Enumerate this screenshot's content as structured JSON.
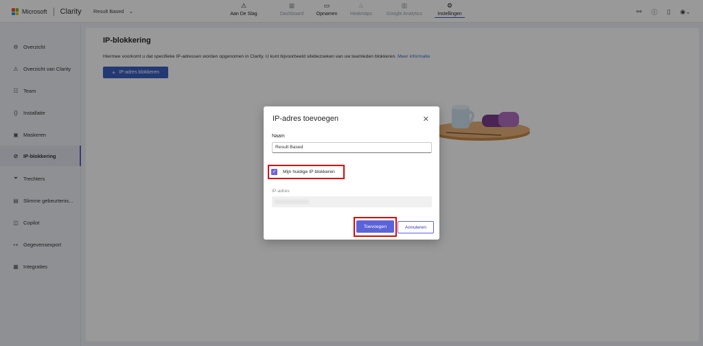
{
  "topbar": {
    "brand": "Microsoft",
    "product": "Clarity",
    "project": "Result Based",
    "nav": [
      {
        "label": "Aan De Slag",
        "icon": "warning-triangle-icon"
      },
      {
        "label": "Dashboard",
        "icon": "dashboard-icon"
      },
      {
        "label": "Opnamen",
        "icon": "video-camera-icon"
      },
      {
        "label": "Heatmaps",
        "icon": "flame-icon"
      },
      {
        "label": "Google Analytics",
        "icon": "bar-chart-icon"
      },
      {
        "label": "Instellingen",
        "icon": "gear-icon"
      }
    ],
    "right_icons": [
      "share-icon",
      "help-icon",
      "document-icon",
      "account-icon"
    ]
  },
  "sidebar": {
    "items": [
      {
        "label": "Overzicht",
        "icon": "gear-icon"
      },
      {
        "label": "Overzicht van Clarity",
        "icon": "warning-triangle-icon"
      },
      {
        "label": "Team",
        "icon": "team-icon"
      },
      {
        "label": "Installatie",
        "icon": "code-braces-icon"
      },
      {
        "label": "Maskeren",
        "icon": "mask-icon"
      },
      {
        "label": "IP-blokkering",
        "icon": "globe-block-icon"
      },
      {
        "label": "Trechters",
        "icon": "funnel-icon"
      },
      {
        "label": "Slimme gebeurtenis...",
        "icon": "smart-event-icon"
      },
      {
        "label": "Copilot",
        "icon": "copilot-icon"
      },
      {
        "label": "Gegevensexport",
        "icon": "export-arrow-icon"
      },
      {
        "label": "Integraties",
        "icon": "integrations-icon"
      }
    ]
  },
  "main": {
    "title": "IP-blokkering",
    "description": "Hiermee voorkomt u dat specifieke IP-adressen worden opgenomen in Clarity. U kunt bijvoorbeeld sitebezoeken van uw teamleden blokkeren.",
    "more_info": "Meer informatie",
    "block_button": "IP-adres blokkeren"
  },
  "modal": {
    "title": "IP-adres toevoegen",
    "name_label": "Naam",
    "name_value": "Result Based",
    "checkbox_label": "Mijn huidige IP blokkeren",
    "checkbox_checked": true,
    "ip_label": "IP-adres",
    "add_button": "Toevoegen",
    "cancel_button": "Annuleren"
  },
  "colors": {
    "accent": "#5b63d9",
    "highlight": "#e00000",
    "primary_button": "#3b5fc0"
  }
}
